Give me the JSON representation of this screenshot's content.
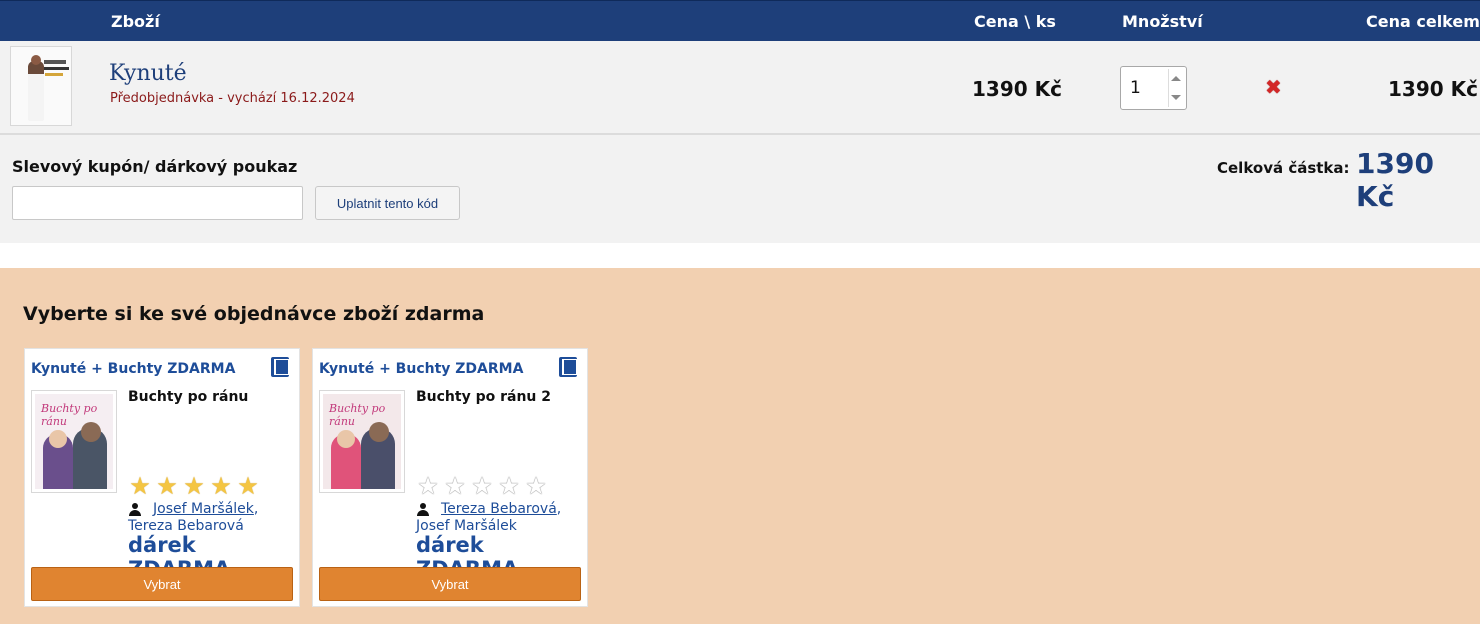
{
  "header": {
    "product": "Zboží",
    "price_per_unit": "Cena \\ ks",
    "quantity": "Množství",
    "total": "Cena celkem"
  },
  "item": {
    "title": "Kynuté",
    "subtitle": "Předobjednávka - vychází 16.12.2024",
    "price": "1390 Kč",
    "quantity": "1",
    "total": "1390 Kč",
    "cover_icon": "book-cover-josef-marsalek"
  },
  "coupon": {
    "label": "Slevový kupón/ dárkový poukaz",
    "input_value": "",
    "input_placeholder": "",
    "apply_label": "Uplatnit tento kód"
  },
  "summary": {
    "label": "Celková částka:",
    "value": "1390 Kč"
  },
  "gifts": {
    "title": "Vyberte si ke své objednávce zboží zdarma",
    "cards": [
      {
        "header": "Kynuté + Buchty ZDARMA",
        "book": "Buchty po ránu",
        "cover_text": "Buchty po ránu",
        "rating": 5,
        "author_1": "Josef Maršálek",
        "author_sep": ",",
        "author_2": "Tereza Bebarová",
        "gift_label": "dárek ZDARMA",
        "button": "Vybrat"
      },
      {
        "header": "Kynuté + Buchty ZDARMA",
        "book": "Buchty po ránu 2",
        "cover_text": "Buchty po ránu",
        "rating": 0,
        "author_1": "Tereza Bebarová",
        "author_sep": ",",
        "author_2": "Josef Maršálek",
        "gift_label": "dárek ZDARMA",
        "button": "Vybrat"
      }
    ]
  },
  "colors": {
    "header_bg": "#1e3f7a",
    "accent_blue": "#1e4d99",
    "gift_bg": "#f2d0b1",
    "button_orange": "#e08430",
    "preorder_red": "#8b1a1a",
    "remove_red": "#d32727"
  }
}
